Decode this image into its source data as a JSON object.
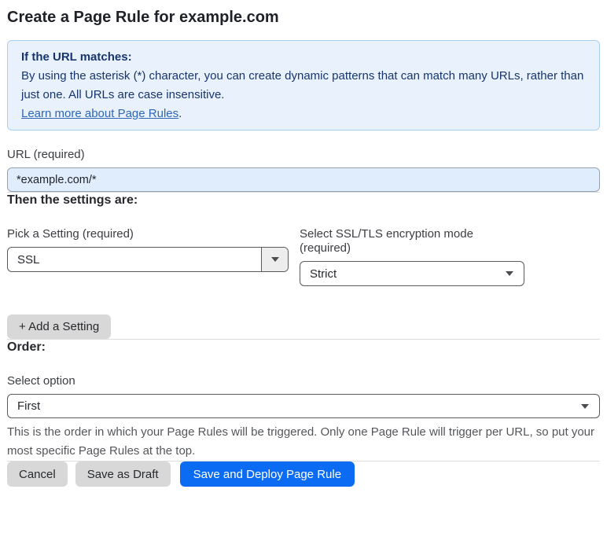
{
  "page": {
    "title": "Create a Page Rule for example.com"
  },
  "info_box": {
    "heading": "If the URL matches:",
    "body": "By using the asterisk (*) character, you can create dynamic patterns that can match many URLs, rather than just one. All URLs are case insensitive.",
    "link_label": "Learn more about Page Rules",
    "link_suffix": "."
  },
  "url_field": {
    "label": "URL (required)",
    "value": "*example.com/*"
  },
  "settings_section": {
    "heading": "Then the settings are:",
    "setting_select": {
      "label": "Pick a Setting (required)",
      "value": "SSL"
    },
    "mode_select": {
      "label": "Select SSL/TLS encryption mode (required)",
      "value": "Strict"
    },
    "add_setting_label": "+ Add a Setting"
  },
  "order_section": {
    "heading": "Order:",
    "select_label": "Select option",
    "select_value": "First",
    "help_text": "This is the order in which your Page Rules will be triggered. Only one Page Rule will trigger per URL, so put your most specific Page Rules at the top."
  },
  "footer": {
    "cancel_label": "Cancel",
    "save_draft_label": "Save as Draft",
    "save_deploy_label": "Save and Deploy Page Rule"
  },
  "colors": {
    "primary_blue": "#0b6cf3",
    "info_box_bg": "#e9f2fc",
    "info_box_border": "#a9cfef",
    "info_box_text": "#16356e",
    "link_blue": "#2d66ba",
    "url_input_bg": "#e0edfc",
    "url_input_border": "#93a2b3",
    "gray_button_bg": "#d8d8d8",
    "select_border": "#595a5d",
    "divider": "#dcdcdc"
  }
}
